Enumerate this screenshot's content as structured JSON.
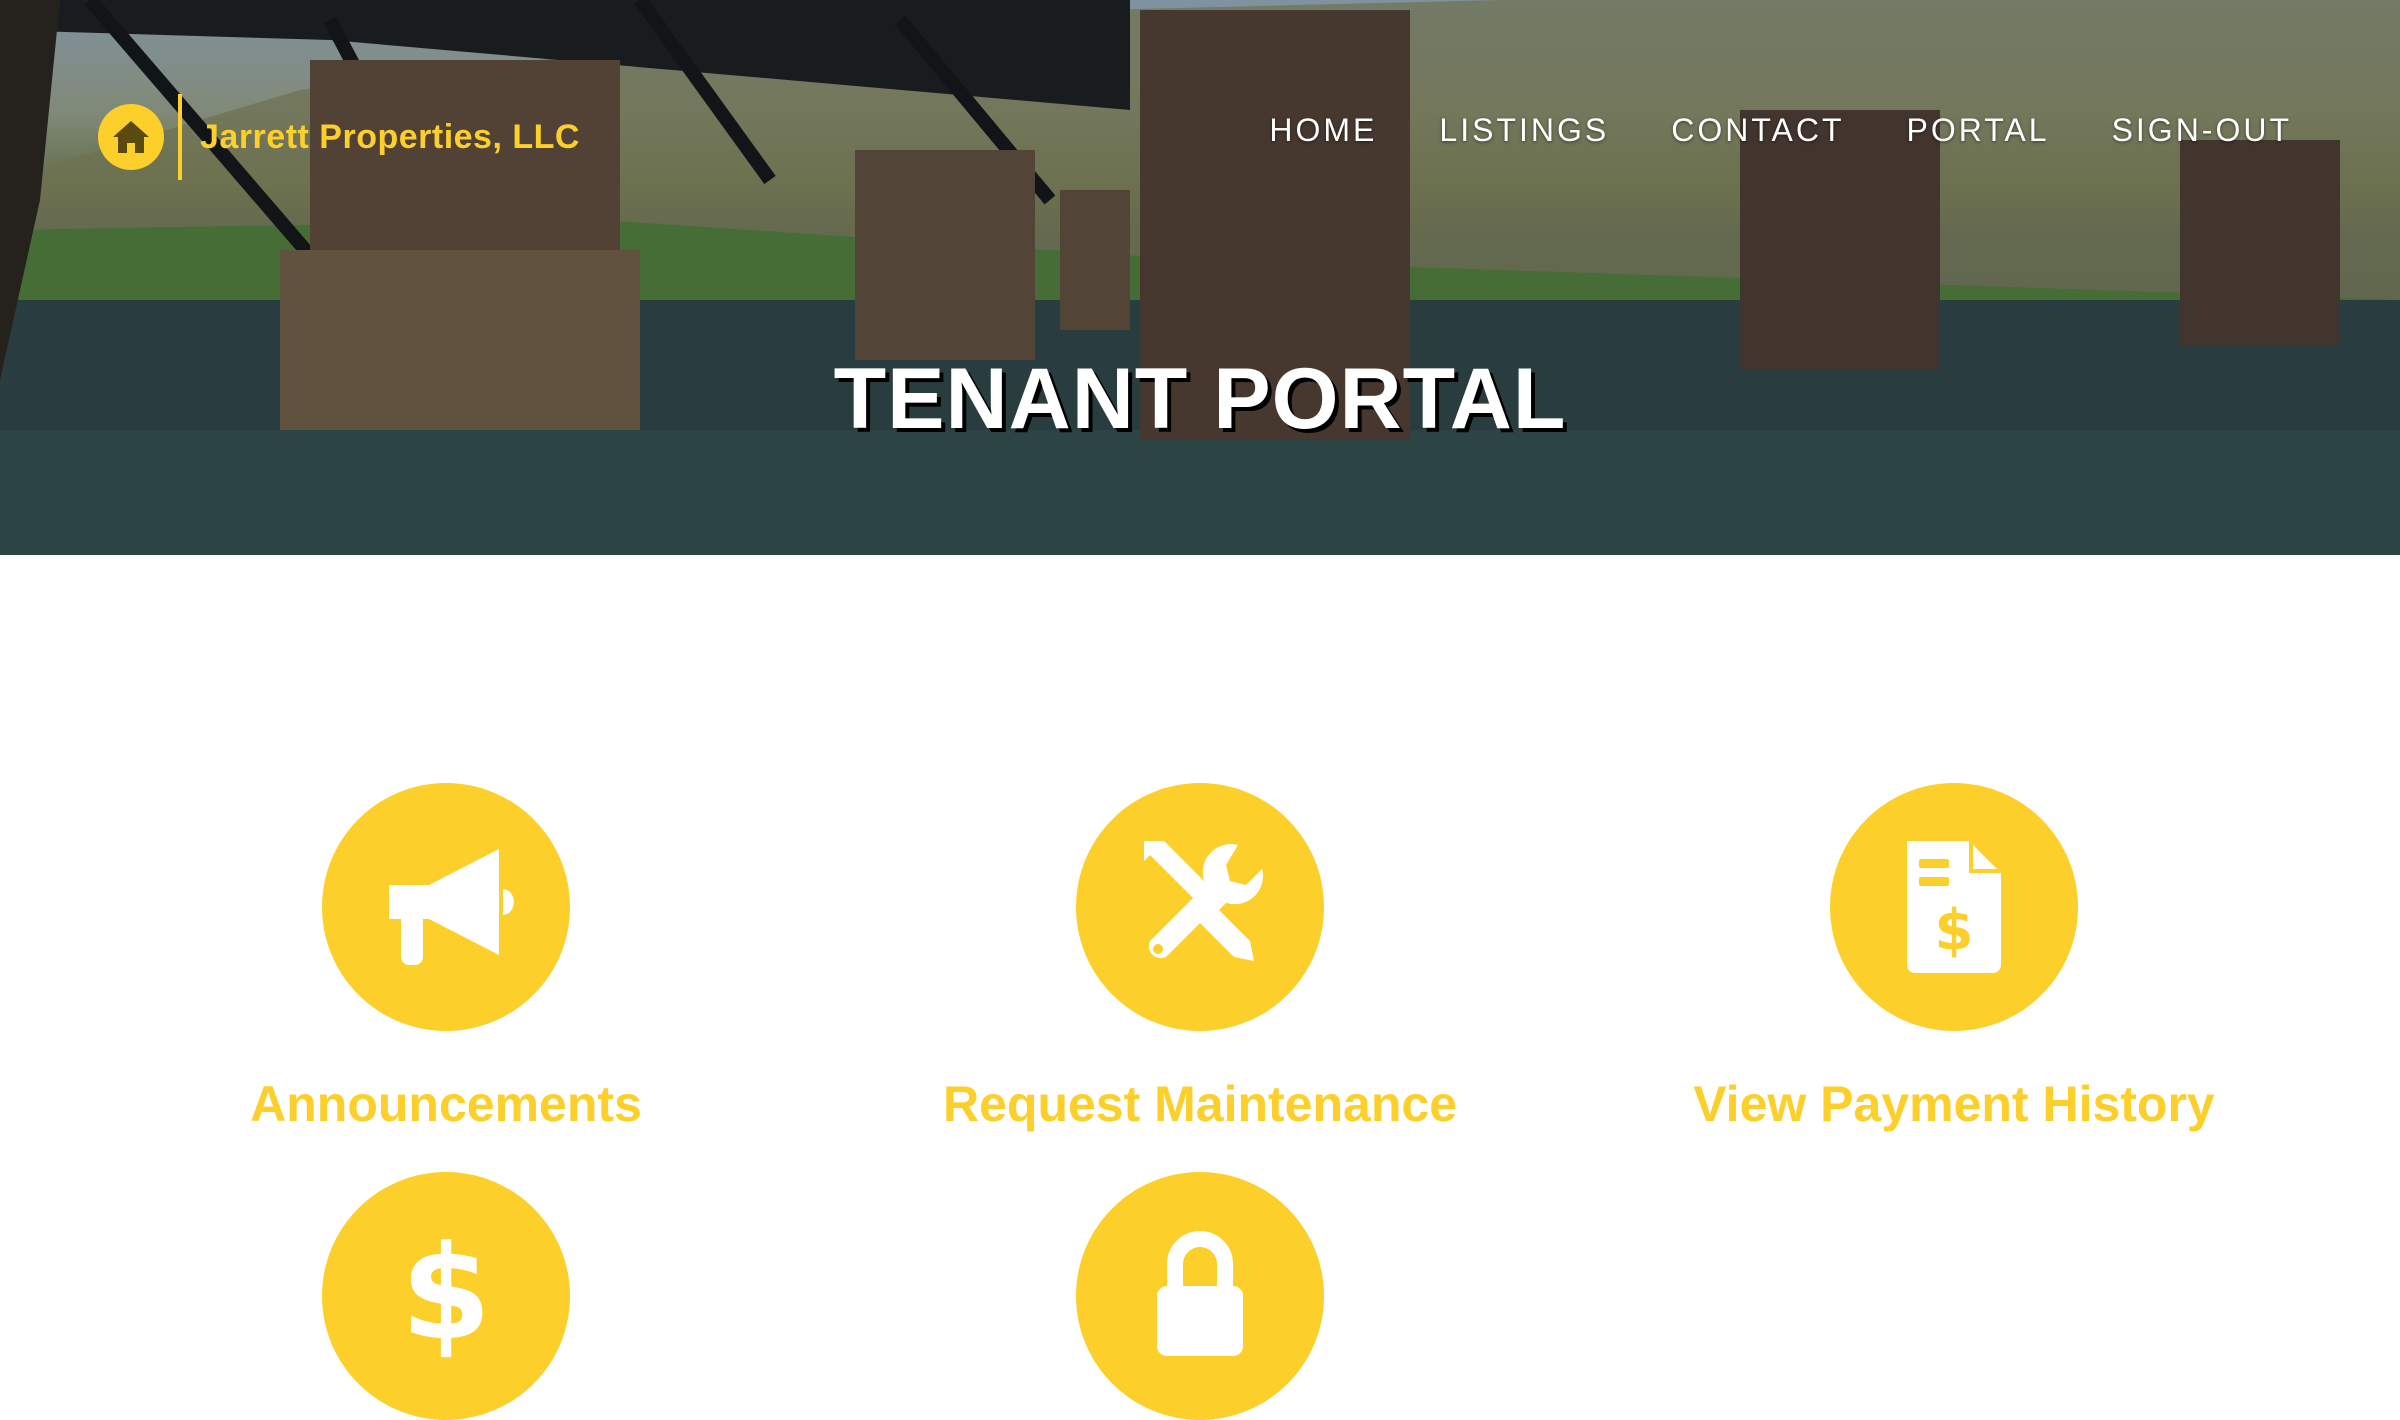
{
  "brand": {
    "name": "Jarrett Properties, LLC",
    "accent_color": "#fdcf2b",
    "logo_icon": "house-icon"
  },
  "nav": {
    "items": [
      {
        "label": "HOME"
      },
      {
        "label": "LISTINGS"
      },
      {
        "label": "CONTACT"
      },
      {
        "label": "PORTAL"
      },
      {
        "label": "SIGN-OUT"
      }
    ]
  },
  "hero": {
    "title": "TENANT PORTAL"
  },
  "portal": {
    "tiles": [
      {
        "label": "Announcements",
        "icon": "megaphone-icon"
      },
      {
        "label": "Request Maintenance",
        "icon": "tools-icon"
      },
      {
        "label": "View Payment History",
        "icon": "invoice-dollar-icon"
      },
      {
        "label": "",
        "icon": "dollar-icon"
      },
      {
        "label": "",
        "icon": "lock-icon"
      }
    ]
  }
}
